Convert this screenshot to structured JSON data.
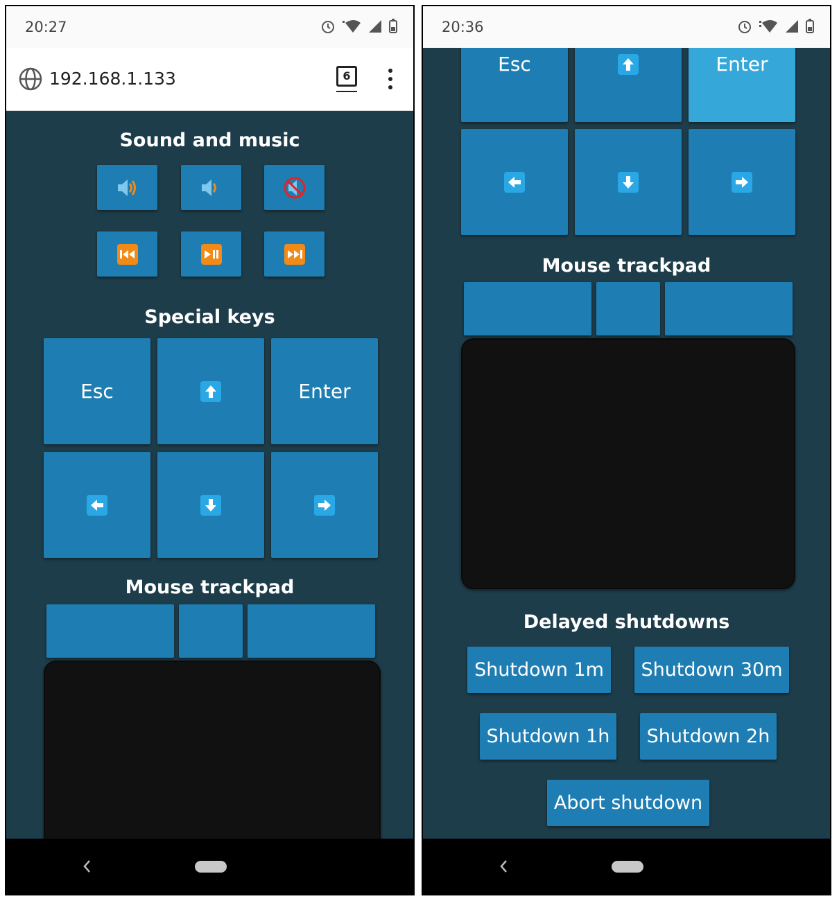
{
  "left": {
    "status_time": "20:27",
    "url": "192.168.1.133",
    "tab_count": "6",
    "sound_heading": "Sound and music",
    "special_heading": "Special keys",
    "keys": {
      "esc": "Esc",
      "enter": "Enter"
    },
    "mouse_heading": "Mouse trackpad"
  },
  "right": {
    "status_time": "20:36",
    "keys": {
      "esc": "Esc",
      "enter": "Enter"
    },
    "mouse_heading": "Mouse trackpad",
    "shutdown_heading": "Delayed shutdowns",
    "shutdown": {
      "m1": "Shutdown 1m",
      "m30": "Shutdown 30m",
      "h1": "Shutdown 1h",
      "h2": "Shutdown 2h",
      "abort": "Abort shutdown"
    }
  },
  "colors": {
    "page_bg": "#1e3d4a",
    "button": "#1e7eb3",
    "button_active": "#36a7d9",
    "arrow_icon": "#2aa8e6",
    "media_icon": "#f28a17",
    "trackpad": "#111111"
  },
  "icons": {
    "volume_up": "volume-up-icon",
    "volume_down": "volume-down-icon",
    "mute": "mute-icon",
    "previous": "previous-track-icon",
    "play_pause": "play-pause-icon",
    "next": "next-track-icon",
    "arrows": [
      "arrow-up-icon",
      "arrow-left-icon",
      "arrow-down-icon",
      "arrow-right-icon"
    ]
  }
}
